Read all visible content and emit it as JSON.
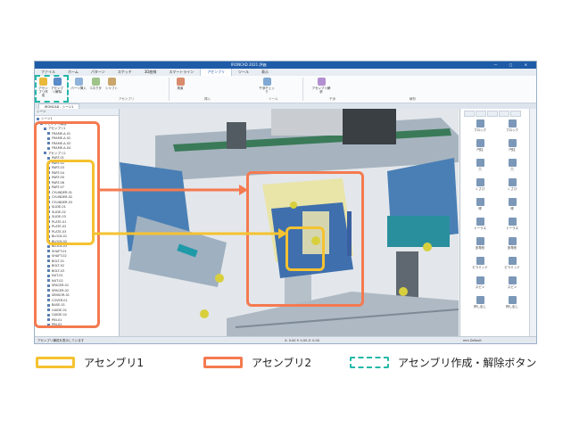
{
  "window": {
    "title": "IRONCAD 2021 評価",
    "controls": "— ▢ ✕"
  },
  "menu": {
    "items": [
      "ファイル",
      "ホーム",
      "パターン",
      "スケッチ",
      "3D曲線",
      "スマートライン",
      "アセンブリ",
      "ツール",
      "表示"
    ],
    "active_index": 6
  },
  "ribbon": {
    "create_assembly_label": "アセンブリ作成",
    "dissolve_assembly_label": "アセンブリ解除",
    "buttons": [
      "パーツ挿入",
      "コネクタ",
      "シャフト",
      "拘束",
      "干渉チェック",
      "アセンブリ解析"
    ],
    "groups": [
      "アセンブリ",
      "挿入",
      "ツール",
      "干渉",
      "解析"
    ]
  },
  "doc_tab": {
    "label": "IRONCAD - シーン1"
  },
  "tree": {
    "header": "シーン",
    "items": [
      "シーン1",
      "アセンブリ構成",
      "アセンブリ1",
      "FRAME-A-01",
      "FRAME-A-02",
      "FRAME-A-03",
      "FRAME-A-04",
      "アセンブリ2",
      "PART-01",
      "PART-02",
      "PART-03",
      "PART-04",
      "PART-05",
      "PART-06",
      "PART-07",
      "CYLINDER-01",
      "CYLINDER-02",
      "CYLINDER-03",
      "SLIDE-01",
      "SLIDE-02",
      "SLIDE-03",
      "PLATE-01",
      "PLATE-02",
      "PLATE-03",
      "BLOCK-01",
      "BLOCK-02",
      "BLOCK-03",
      "SHAFT-01",
      "SHAFT-02",
      "BOLT-01",
      "BOLT-02",
      "BOLT-03",
      "NUT-01",
      "NUT-02",
      "SPACER-01",
      "SPACER-02",
      "SENSOR-01",
      "COVER-01",
      "BASE-01",
      "GUIDE-01",
      "GUIDE-02",
      "PIN-01",
      "PIN-02"
    ]
  },
  "right_panel": {
    "items": [
      "ブロック",
      "ブロック",
      "円柱",
      "円柱",
      "穴",
      "穴",
      "くさび",
      "くさび",
      "球",
      "球",
      "トーラス",
      "トーラス",
      "多角形",
      "多角形",
      "ピラミッド",
      "ピラミッド",
      "スピン",
      "スピン",
      "押し出し",
      "押し出し"
    ]
  },
  "status": {
    "left": "アセンブリ構成を表示しています",
    "mid": "X: 0.00  Y: 0.00  Z: 0.00",
    "right": "mm  Default"
  },
  "legend": {
    "assembly1": "アセンブリ1",
    "assembly2": "アセンブリ2",
    "buttons": "アセンブリ作成・解除ボタン"
  },
  "colors": {
    "assembly1": "#f5c230",
    "assembly2": "#f47a50",
    "buttons": "#22b8a8",
    "frame": "#1f5ca8"
  }
}
